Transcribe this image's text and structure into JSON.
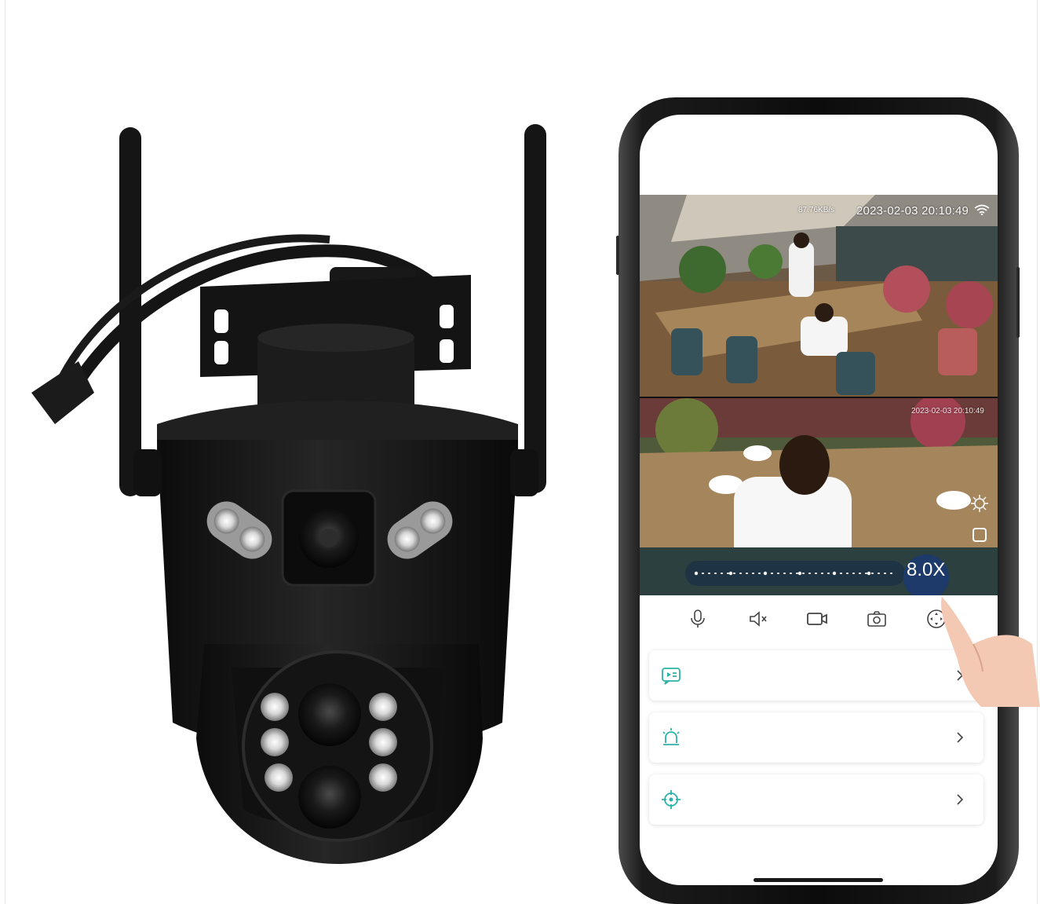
{
  "live_view": {
    "bitrate": "87.76KB/s",
    "timestamp": "2023-02-03 20:10:49",
    "secondary_timestamp": "2023-02-03 20:10:49",
    "zoom_level": "8.0X"
  },
  "toolbar": {
    "icons": [
      "microphone-icon",
      "mute-icon",
      "record-icon",
      "snapshot-icon",
      "ptz-control-icon"
    ]
  },
  "menu": {
    "items": [
      {
        "icon": "playback-icon"
      },
      {
        "icon": "alarm-icon"
      },
      {
        "icon": "preset-position-icon"
      }
    ]
  },
  "colors": {
    "accent": "#2bb3a8",
    "zoom_badge": "#1d3a6b",
    "camera_body": "#1a1a1a"
  }
}
